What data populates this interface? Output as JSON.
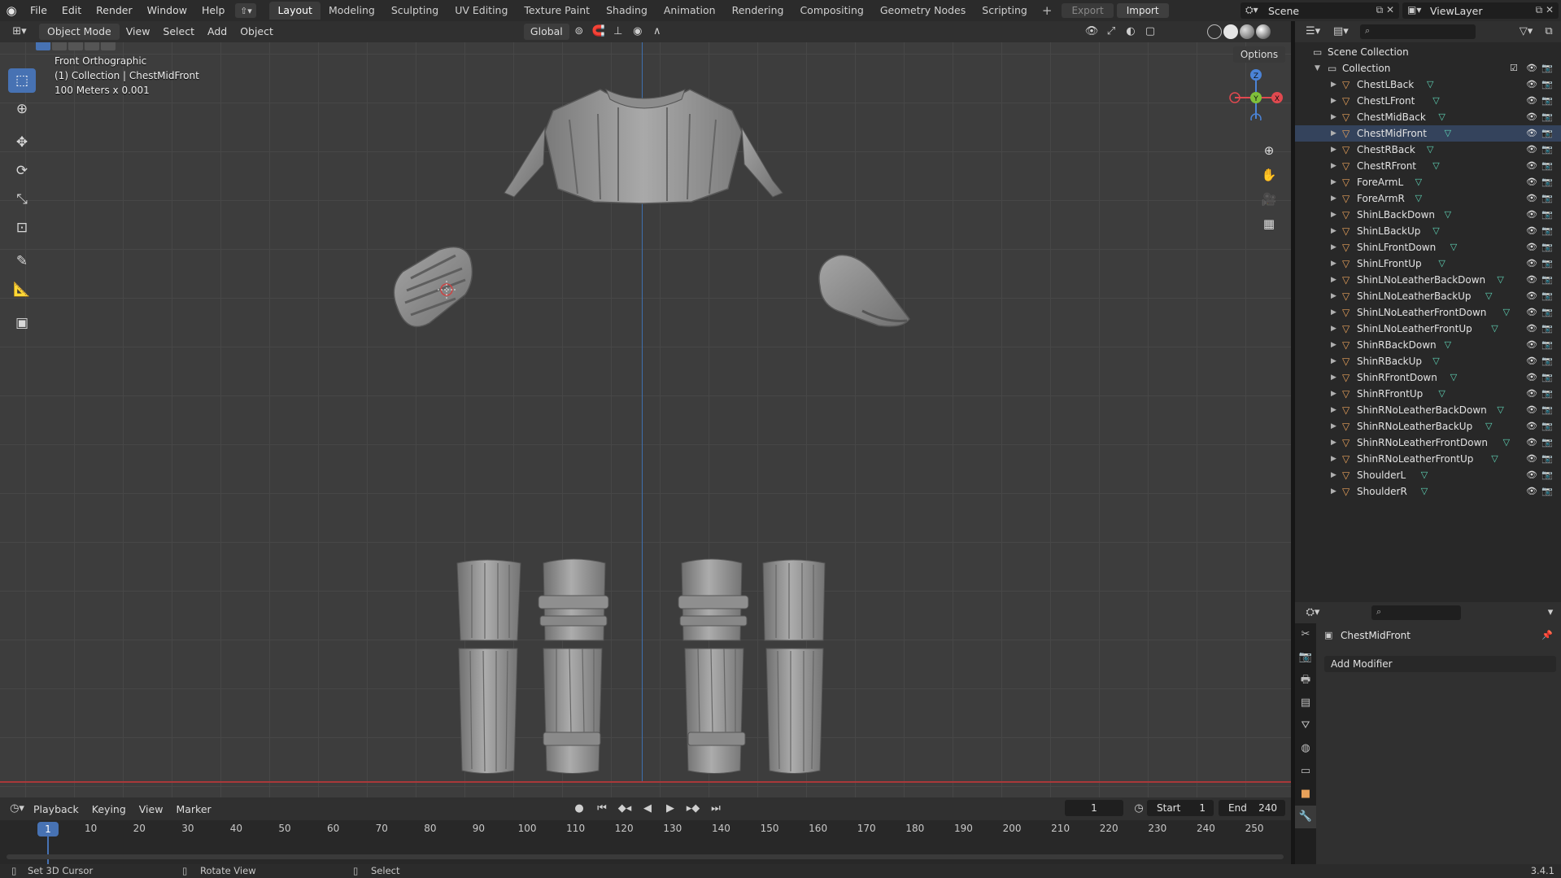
{
  "topbar": {
    "menus": [
      "File",
      "Edit",
      "Render",
      "Window",
      "Help"
    ],
    "workspaces": [
      "Layout",
      "Modeling",
      "Sculpting",
      "UV Editing",
      "Texture Paint",
      "Shading",
      "Animation",
      "Rendering",
      "Compositing",
      "Geometry Nodes",
      "Scripting"
    ],
    "active_workspace": "Layout",
    "export_label": "Export",
    "import_label": "Import",
    "scene": "Scene",
    "view_layer": "ViewLayer"
  },
  "viewport_header": {
    "mode": "Object Mode",
    "menus": [
      "View",
      "Select",
      "Add",
      "Object"
    ],
    "orientation": "Global",
    "options_label": "Options"
  },
  "viewport": {
    "view_name": "Front Orthographic",
    "collection_info": "(1) Collection | ChestMidFront",
    "scale_info": "100 Meters x 0.001",
    "gizmo_axes": [
      "Z",
      "Y",
      "X"
    ]
  },
  "outliner": {
    "root": "Scene Collection",
    "collection": "Collection",
    "selected": "ChestMidFront",
    "items": [
      "ChestLBack",
      "ChestLFront",
      "ChestMidBack",
      "ChestMidFront",
      "ChestRBack",
      "ChestRFront",
      "ForeArmL",
      "ForeArmR",
      "ShinLBackDown",
      "ShinLBackUp",
      "ShinLFrontDown",
      "ShinLFrontUp",
      "ShinLNoLeatherBackDown",
      "ShinLNoLeatherBackUp",
      "ShinLNoLeatherFrontDown",
      "ShinLNoLeatherFrontUp",
      "ShinRBackDown",
      "ShinRBackUp",
      "ShinRFrontDown",
      "ShinRFrontUp",
      "ShinRNoLeatherBackDown",
      "ShinRNoLeatherBackUp",
      "ShinRNoLeatherFrontDown",
      "ShinRNoLeatherFrontUp",
      "ShoulderL",
      "ShoulderR"
    ]
  },
  "properties": {
    "object_name": "ChestMidFront",
    "add_modifier_label": "Add Modifier"
  },
  "timeline": {
    "menus": [
      "Playback",
      "Keying",
      "View",
      "Marker"
    ],
    "current_frame": "1",
    "start_label": "Start",
    "start_value": "1",
    "end_label": "End",
    "end_value": "240",
    "ticks": [
      "1",
      "10",
      "20",
      "30",
      "40",
      "50",
      "60",
      "70",
      "80",
      "90",
      "100",
      "110",
      "120",
      "130",
      "140",
      "150",
      "160",
      "170",
      "180",
      "190",
      "200",
      "210",
      "220",
      "230",
      "240",
      "250"
    ]
  },
  "statusbar": {
    "left_hint": "Set 3D Cursor",
    "mid_hint": "Rotate View",
    "right_hint": "Select",
    "version": "3.4.1"
  },
  "colors": {
    "accent": "#4772b3",
    "x_axis": "#e0494f",
    "y_axis": "#7fc03a",
    "z_axis": "#4b83d6",
    "mesh_icon": "#5fd4b6",
    "object_icon": "#e8a15a"
  }
}
